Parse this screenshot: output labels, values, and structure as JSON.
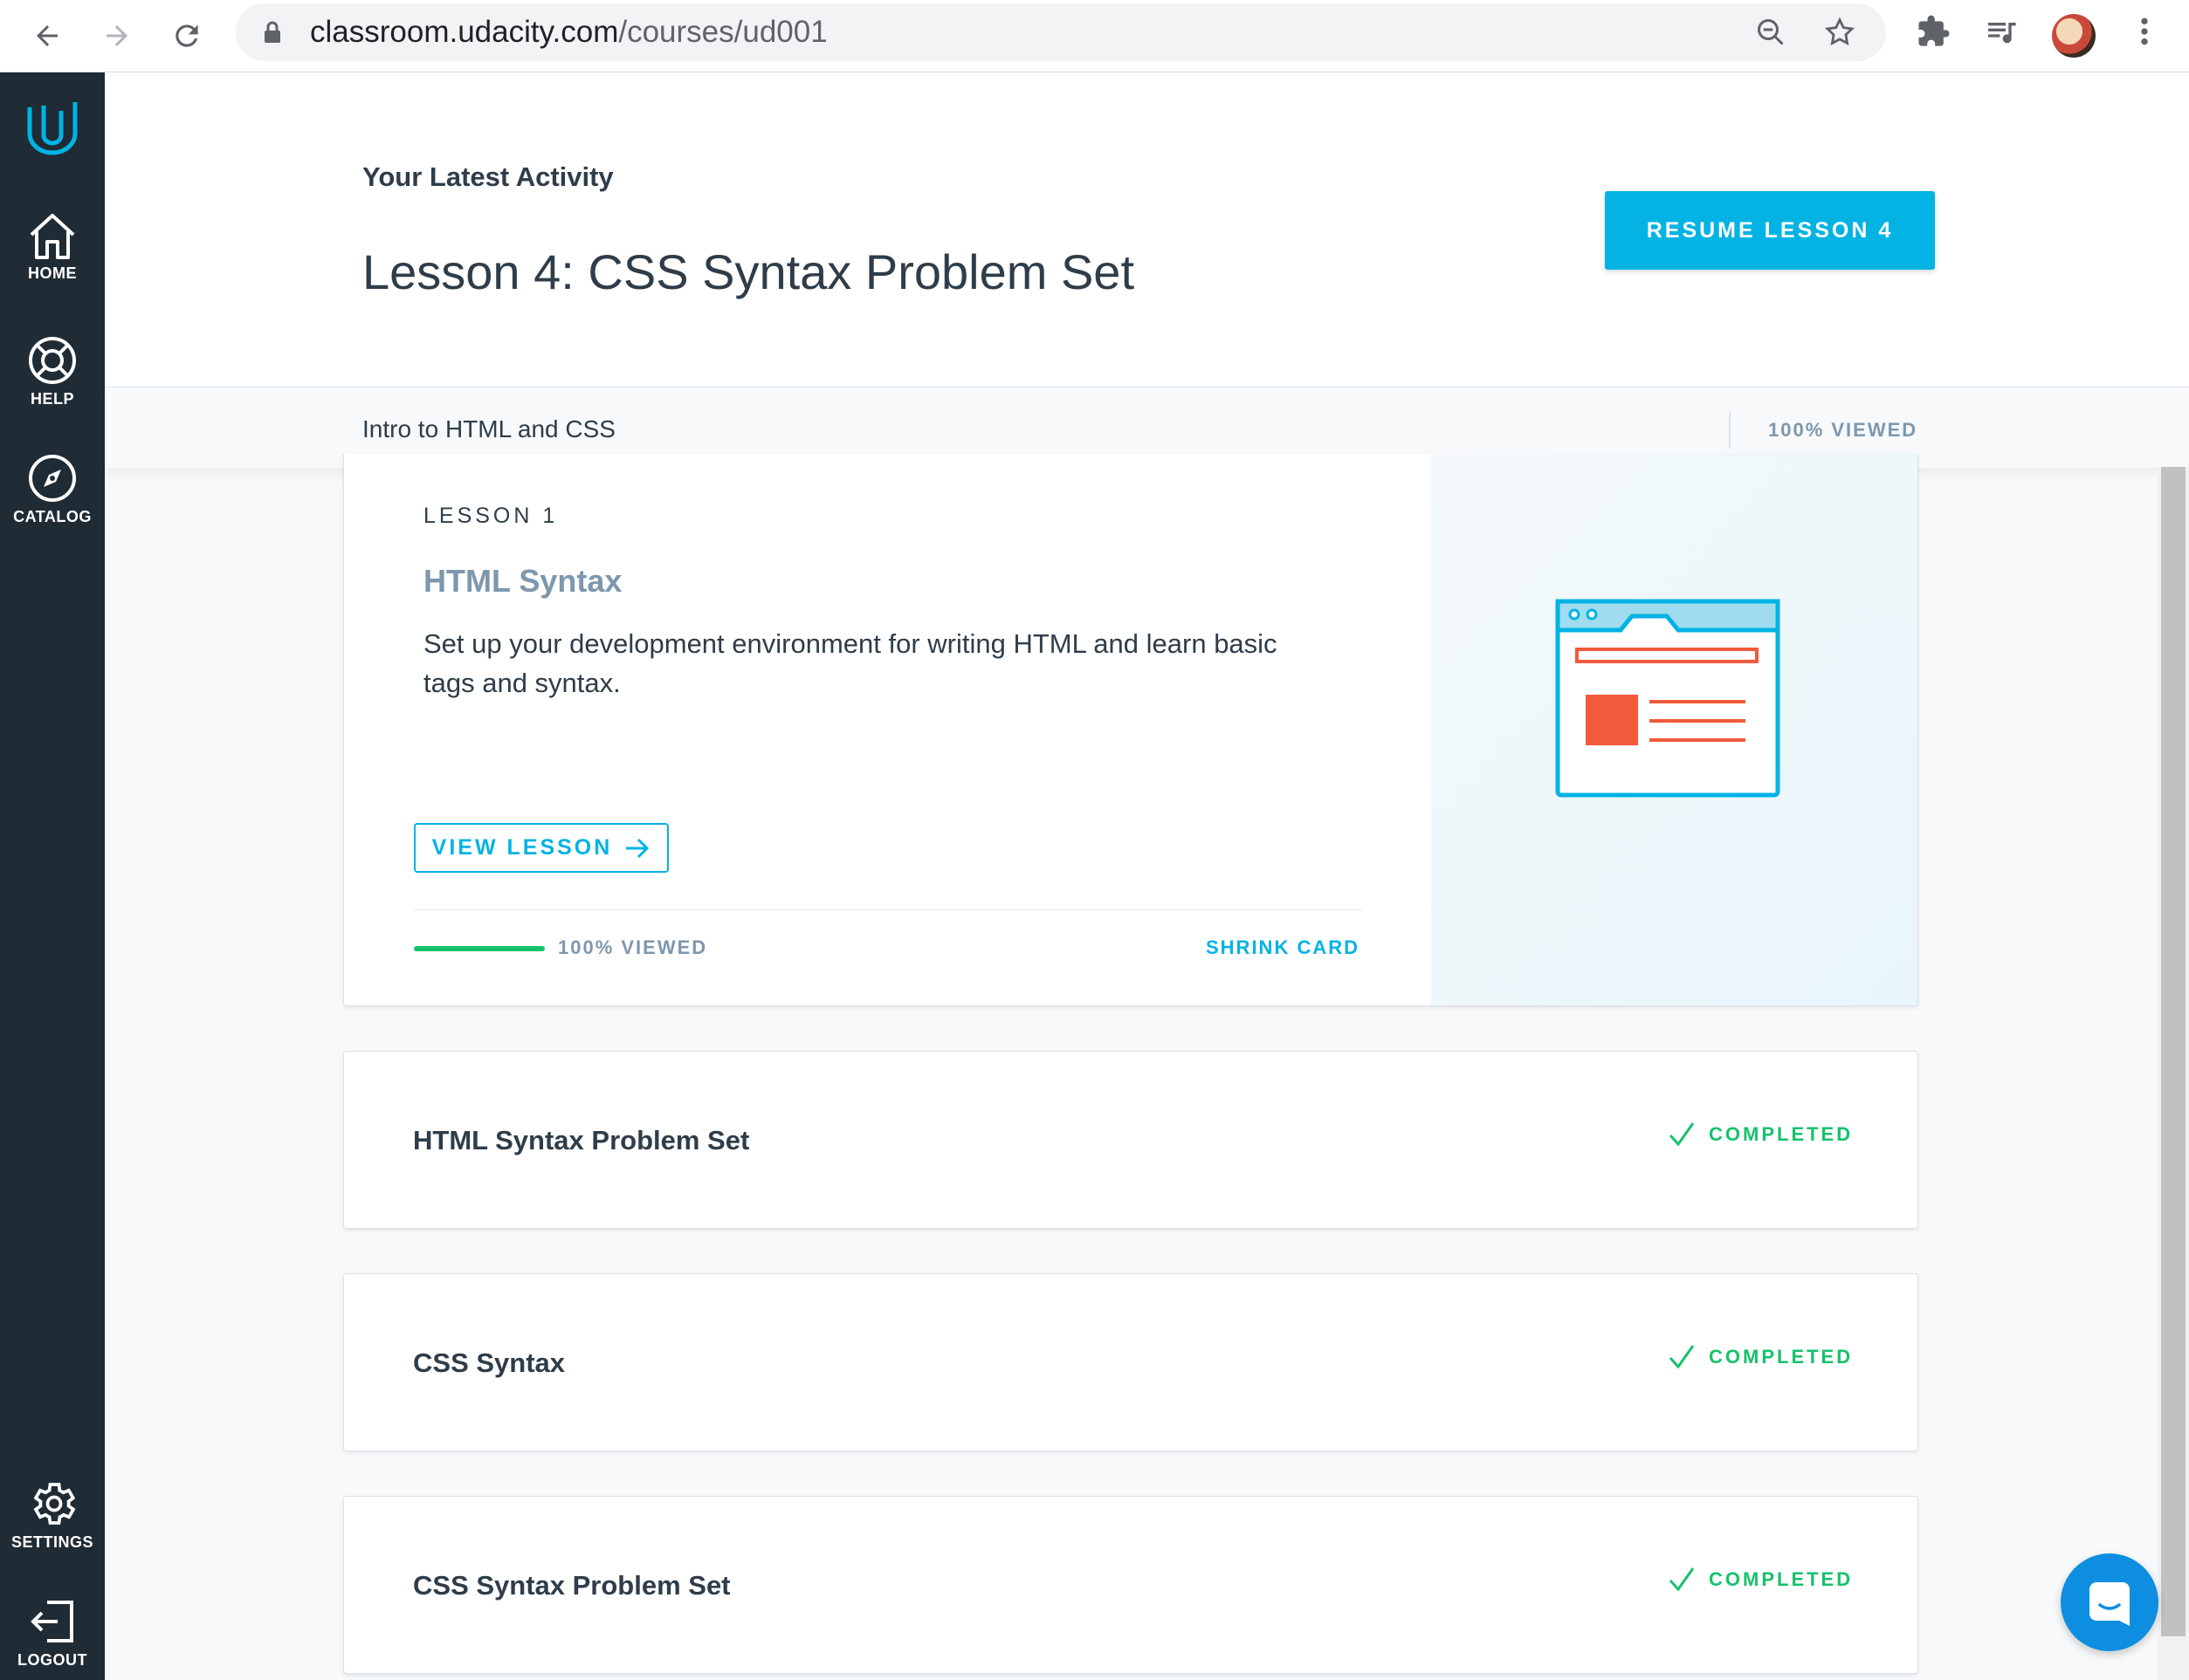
{
  "browser": {
    "url_host": "classroom.udacity.com",
    "url_path": "/courses/ud001"
  },
  "sidebar": {
    "items": [
      {
        "label": "HOME"
      },
      {
        "label": "HELP"
      },
      {
        "label": "CATALOG"
      }
    ],
    "bottom_items": [
      {
        "label": "SETTINGS"
      },
      {
        "label": "LOGOUT"
      }
    ]
  },
  "latest": {
    "kicker": "Your Latest Activity",
    "title": "Lesson 4: CSS Syntax Problem Set",
    "resume_label": "RESUME LESSON 4"
  },
  "course_bar": {
    "name": "Intro to HTML and CSS",
    "viewed": "100% VIEWED"
  },
  "lesson_card": {
    "label": "LESSON 1",
    "title": "HTML Syntax",
    "description": "Set up your development environment for writing HTML and learn basic tags and syntax.",
    "view_label": "VIEW LESSON",
    "progress": 1.0,
    "progress_label": "100% VIEWED",
    "shrink_label": "SHRINK CARD"
  },
  "lessons": [
    {
      "title": "HTML Syntax Problem Set",
      "status": "COMPLETED"
    },
    {
      "title": "CSS Syntax",
      "status": "COMPLETED"
    },
    {
      "title": "CSS Syntax Problem Set",
      "status": "COMPLETED"
    }
  ],
  "colors": {
    "accent": "#02b3e4",
    "success": "#15c26b",
    "sidebar": "#1f2b35"
  }
}
